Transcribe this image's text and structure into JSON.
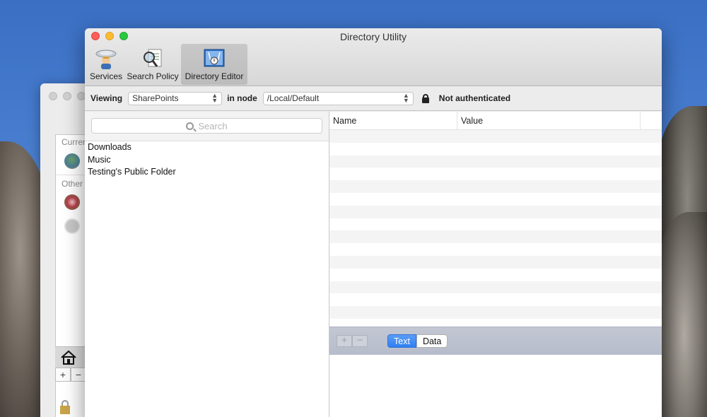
{
  "window": {
    "title": "Directory Utility"
  },
  "toolbar": {
    "items": [
      {
        "label": "Services",
        "icon": "services-icon"
      },
      {
        "label": "Search Policy",
        "icon": "search-policy-icon"
      },
      {
        "label": "Directory Editor",
        "icon": "directory-editor-icon",
        "selected": true
      }
    ]
  },
  "filter": {
    "viewing_label": "Viewing",
    "viewing_value": "SharePoints",
    "in_node_label": "in node",
    "node_value": "/Local/Default",
    "auth_status": "Not authenticated"
  },
  "left_pane": {
    "search_placeholder": "Search",
    "items": [
      "Downloads",
      "Music",
      "Testing's Public Folder"
    ]
  },
  "table": {
    "columns": [
      "Name",
      "Value"
    ]
  },
  "bottom_bar": {
    "add_label": "+",
    "remove_label": "−",
    "text_tab": "Text",
    "data_tab": "Data"
  },
  "bg_window": {
    "section_current": "Curren",
    "section_other": "Other",
    "add_label": "+",
    "remove_label": "−"
  },
  "colors": {
    "accent": "#2f7ff2",
    "close": "#fc5f57",
    "minimize": "#fdbc2e",
    "maximize": "#28c840"
  }
}
